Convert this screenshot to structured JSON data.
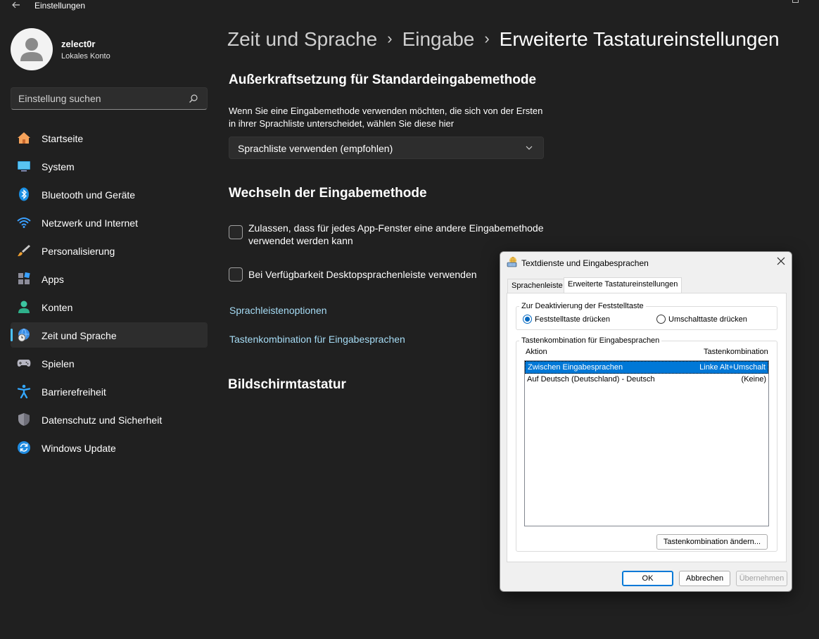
{
  "app": {
    "title": "Einstellungen"
  },
  "profile": {
    "name": "zelect0r",
    "account_type": "Lokales Konto"
  },
  "search": {
    "placeholder": "Einstellung suchen"
  },
  "nav": {
    "items": [
      {
        "label": "Startseite",
        "icon": "home-icon"
      },
      {
        "label": "System",
        "icon": "monitor-icon"
      },
      {
        "label": "Bluetooth und Geräte",
        "icon": "bluetooth-icon"
      },
      {
        "label": "Netzwerk und Internet",
        "icon": "wifi-icon"
      },
      {
        "label": "Personalisierung",
        "icon": "brush-icon"
      },
      {
        "label": "Apps",
        "icon": "apps-icon"
      },
      {
        "label": "Konten",
        "icon": "person-icon"
      },
      {
        "label": "Zeit und Sprache",
        "icon": "globe-clock-icon",
        "selected": true
      },
      {
        "label": "Spielen",
        "icon": "gamepad-icon"
      },
      {
        "label": "Barrierefreiheit",
        "icon": "accessibility-icon"
      },
      {
        "label": "Datenschutz und Sicherheit",
        "icon": "shield-icon"
      },
      {
        "label": "Windows Update",
        "icon": "update-icon"
      }
    ]
  },
  "breadcrumb": {
    "part1": "Zeit und Sprache",
    "part2": "Eingabe",
    "current": "Erweiterte Tastatureinstellungen",
    "separator": "›"
  },
  "main": {
    "override": {
      "heading": "Außerkraftsetzung für Standardeingabemethode",
      "description": "Wenn Sie eine Eingabemethode verwenden möchten, die sich von der Ersten in ihrer Sprachliste unterscheidet, wählen Sie diese hier",
      "dropdown_value": "Sprachliste verwenden (empfohlen)"
    },
    "switching": {
      "heading": "Wechseln der Eingabemethode",
      "checkbox1": "Zulassen, dass für jedes App-Fenster eine andere Eingabemethode verwendet werden kann",
      "checkbox2": "Bei Verfügbarkeit Desktopsprachenleiste verwenden",
      "link1": "Sprachleistenoptionen",
      "link2": "Tastenkombination für Eingabesprachen"
    },
    "onscreen": {
      "heading": "Bildschirmtastatur"
    }
  },
  "dialog": {
    "title": "Textdienste und Eingabesprachen",
    "tabs": [
      "Sprachenleiste",
      "Erweiterte Tastatureinstellungen"
    ],
    "caps_group": {
      "title": "Zur Deaktivierung der Feststelltaste",
      "option1": "Feststelltaste drücken",
      "option2": "Umschalttaste drücken",
      "selected": "option1"
    },
    "hotkey_group": {
      "title": "Tastenkombination für Eingabesprachen",
      "col_action": "Aktion",
      "col_combo": "Tastenkombination",
      "rows": [
        {
          "action": "Zwischen Eingabesprachen",
          "combo": "Linke Alt+Umschalt"
        },
        {
          "action": "Auf Deutsch (Deutschland) - Deutsch",
          "combo": "(Keine)"
        }
      ],
      "change_button": "Tastenkombination ändern..."
    },
    "buttons": {
      "ok": "OK",
      "cancel": "Abbrechen",
      "apply": "Übernehmen"
    }
  },
  "colors": {
    "background": "#202020",
    "accent": "#4cc2ff",
    "link": "#a6dcf5",
    "selection": "#0078d7"
  }
}
